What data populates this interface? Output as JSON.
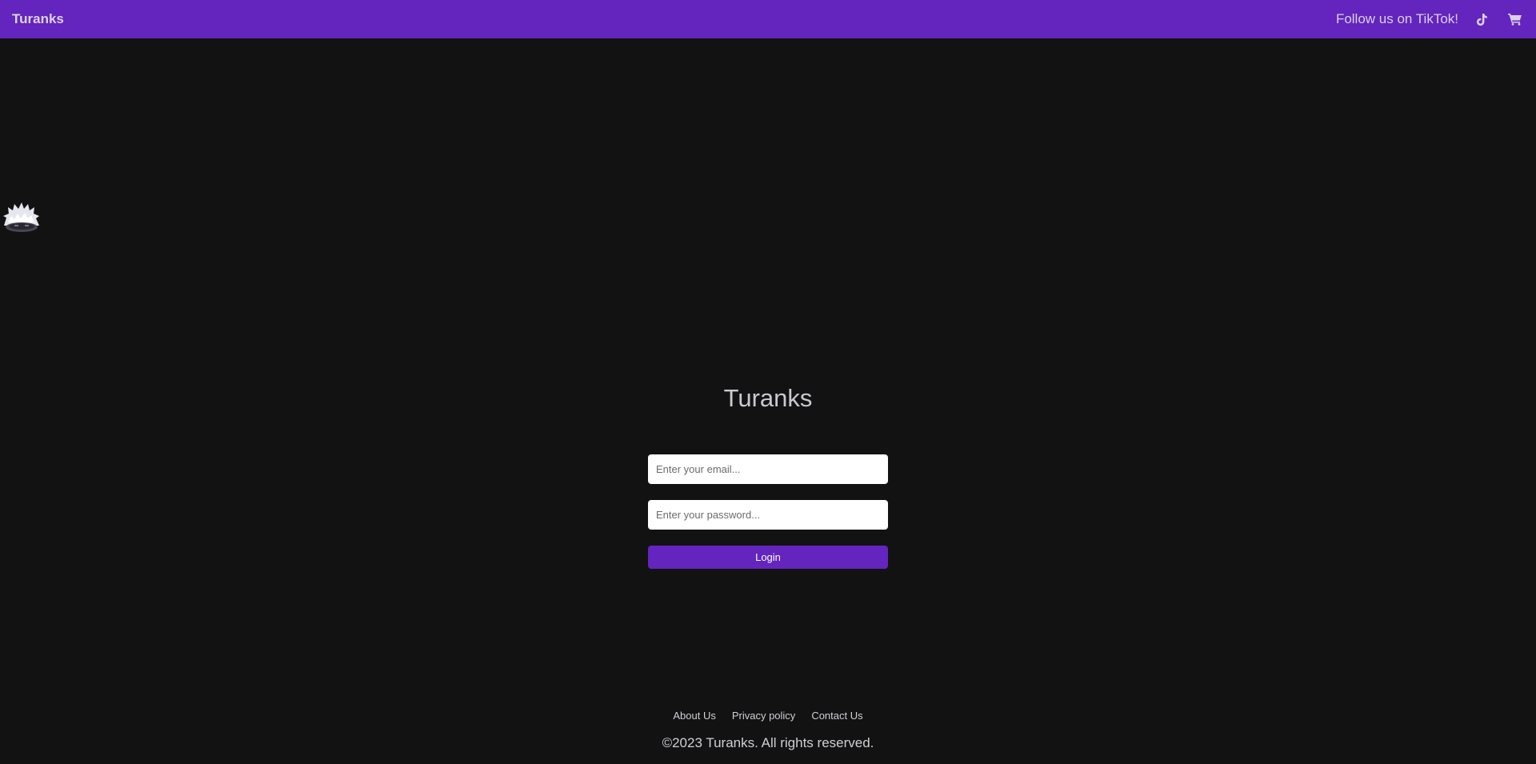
{
  "navbar": {
    "brand": "Turanks",
    "tiktok_text": "Follow us on TikTok!",
    "icons": [
      "tiktok-icon",
      "cart-icon"
    ],
    "background": "#6424be"
  },
  "login": {
    "title": "Turanks",
    "email_placeholder": "Enter your email...",
    "password_placeholder": "Enter your password...",
    "button_label": "Login",
    "button_color": "#6424be"
  },
  "footer": {
    "links": [
      "About Us",
      "Privacy policy",
      "Contact Us"
    ],
    "copyright": "©2023 Turanks. All rights reserved."
  },
  "colors": {
    "page_background": "#121212",
    "accent": "#6424be"
  }
}
